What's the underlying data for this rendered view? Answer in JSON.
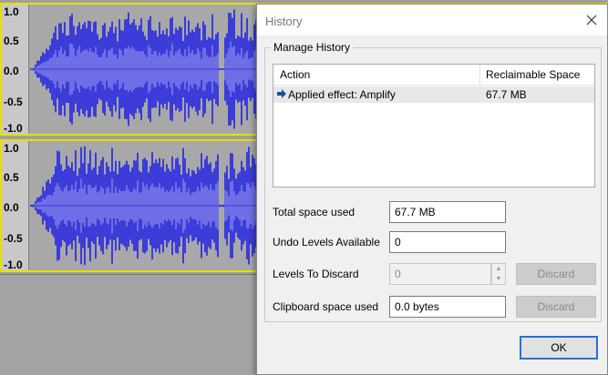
{
  "tracks": {
    "scale_labels": [
      "1.0",
      "0.5",
      "0.0",
      "-0.5",
      "-1.0"
    ]
  },
  "dialog": {
    "title": "History",
    "group_label": "Manage History",
    "list": {
      "columns": [
        "Action",
        "Reclaimable Space"
      ],
      "rows": [
        {
          "icon": "right-arrow-icon",
          "action": "Applied effect: Amplify",
          "space": "67.7 MB"
        }
      ]
    },
    "fields": {
      "total_space_label": "Total space used",
      "total_space_value": "67.7 MB",
      "undo_levels_label": "Undo Levels Available",
      "undo_levels_value": "0",
      "levels_discard_label": "Levels To Discard",
      "levels_discard_value": "0",
      "clipboard_label": "Clipboard space used",
      "clipboard_value": "0.0 bytes"
    },
    "buttons": {
      "discard_label": "Discard",
      "discard_clipboard_label": "Discard",
      "ok_label": "OK"
    }
  },
  "colors": {
    "wave": "#3c3cd8",
    "wave_core": "#6e6ee6",
    "track_border": "#e8e000",
    "ok_border": "#2a6fd6"
  }
}
